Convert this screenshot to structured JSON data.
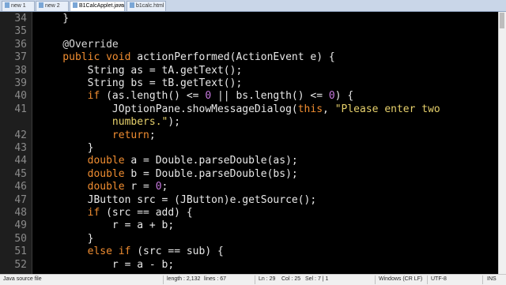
{
  "tabs": [
    {
      "label": "new 1",
      "active": false
    },
    {
      "label": "new 2",
      "active": false
    },
    {
      "label": "B1CalcApplet.java",
      "active": true
    },
    {
      "label": "b1calc.html",
      "active": false
    }
  ],
  "editor": {
    "line_numbers": [
      "34",
      "35",
      "36",
      "37",
      "38",
      "39",
      "40",
      "41",
      "",
      "42",
      "43",
      "44",
      "45",
      "46",
      "47",
      "48",
      "49",
      "50",
      "51",
      "52"
    ],
    "lines": [
      [
        {
          "t": "    }",
          "c": "txt"
        }
      ],
      [],
      [
        {
          "t": "    @Override",
          "c": "ann"
        }
      ],
      [
        {
          "t": "    public void ",
          "c": "kw"
        },
        {
          "t": "actionPerformed(ActionEvent e) {",
          "c": "txt"
        }
      ],
      [
        {
          "t": "        String as = tA.getText();",
          "c": "txt"
        }
      ],
      [
        {
          "t": "        String bs = tB.getText();",
          "c": "txt"
        }
      ],
      [
        {
          "t": "        if ",
          "c": "kw"
        },
        {
          "t": "(as.length() <= ",
          "c": "txt"
        },
        {
          "t": "0",
          "c": "num"
        },
        {
          "t": " || bs.length() <= ",
          "c": "txt"
        },
        {
          "t": "0",
          "c": "num"
        },
        {
          "t": ") {",
          "c": "txt"
        }
      ],
      [
        {
          "t": "            JOptionPane.showMessageDialog(",
          "c": "txt"
        },
        {
          "t": "this",
          "c": "kw"
        },
        {
          "t": ", ",
          "c": "txt"
        },
        {
          "t": "\"Please enter two",
          "c": "str"
        }
      ],
      [
        {
          "t": "            numbers.\"",
          "c": "str"
        },
        {
          "t": ");",
          "c": "txt"
        }
      ],
      [
        {
          "t": "            return",
          "c": "kw"
        },
        {
          "t": ";",
          "c": "txt"
        }
      ],
      [
        {
          "t": "        }",
          "c": "txt"
        }
      ],
      [
        {
          "t": "        double ",
          "c": "kw"
        },
        {
          "t": "a = Double.parseDouble(as);",
          "c": "txt"
        }
      ],
      [
        {
          "t": "        double ",
          "c": "kw"
        },
        {
          "t": "b = Double.parseDouble(bs);",
          "c": "txt"
        }
      ],
      [
        {
          "t": "        double ",
          "c": "kw"
        },
        {
          "t": "r = ",
          "c": "txt"
        },
        {
          "t": "0",
          "c": "num"
        },
        {
          "t": ";",
          "c": "txt"
        }
      ],
      [
        {
          "t": "        JButton src = (JButton)e.getSource();",
          "c": "txt"
        }
      ],
      [
        {
          "t": "        if ",
          "c": "kw"
        },
        {
          "t": "(src == add) {",
          "c": "txt"
        }
      ],
      [
        {
          "t": "            r = a + b;",
          "c": "txt"
        }
      ],
      [
        {
          "t": "        }",
          "c": "txt"
        }
      ],
      [
        {
          "t": "        else if ",
          "c": "kw"
        },
        {
          "t": "(src == sub) {",
          "c": "txt"
        }
      ],
      [
        {
          "t": "            r = a - b;",
          "c": "txt"
        }
      ]
    ]
  },
  "status": {
    "file_type": "Java source file",
    "length": "length : 2,132",
    "lines": "lines : 67",
    "ln": "Ln : 29",
    "col": "Col : 25",
    "sel": "Sel : 7 | 1",
    "eol": "Windows (CR LF)",
    "encoding": "UTF-8",
    "mode": "INS"
  },
  "colors": {
    "keyword": "#f08d31",
    "number": "#c678dd",
    "string": "#e6d06b",
    "text": "#e8e8e8",
    "background": "#000000"
  }
}
